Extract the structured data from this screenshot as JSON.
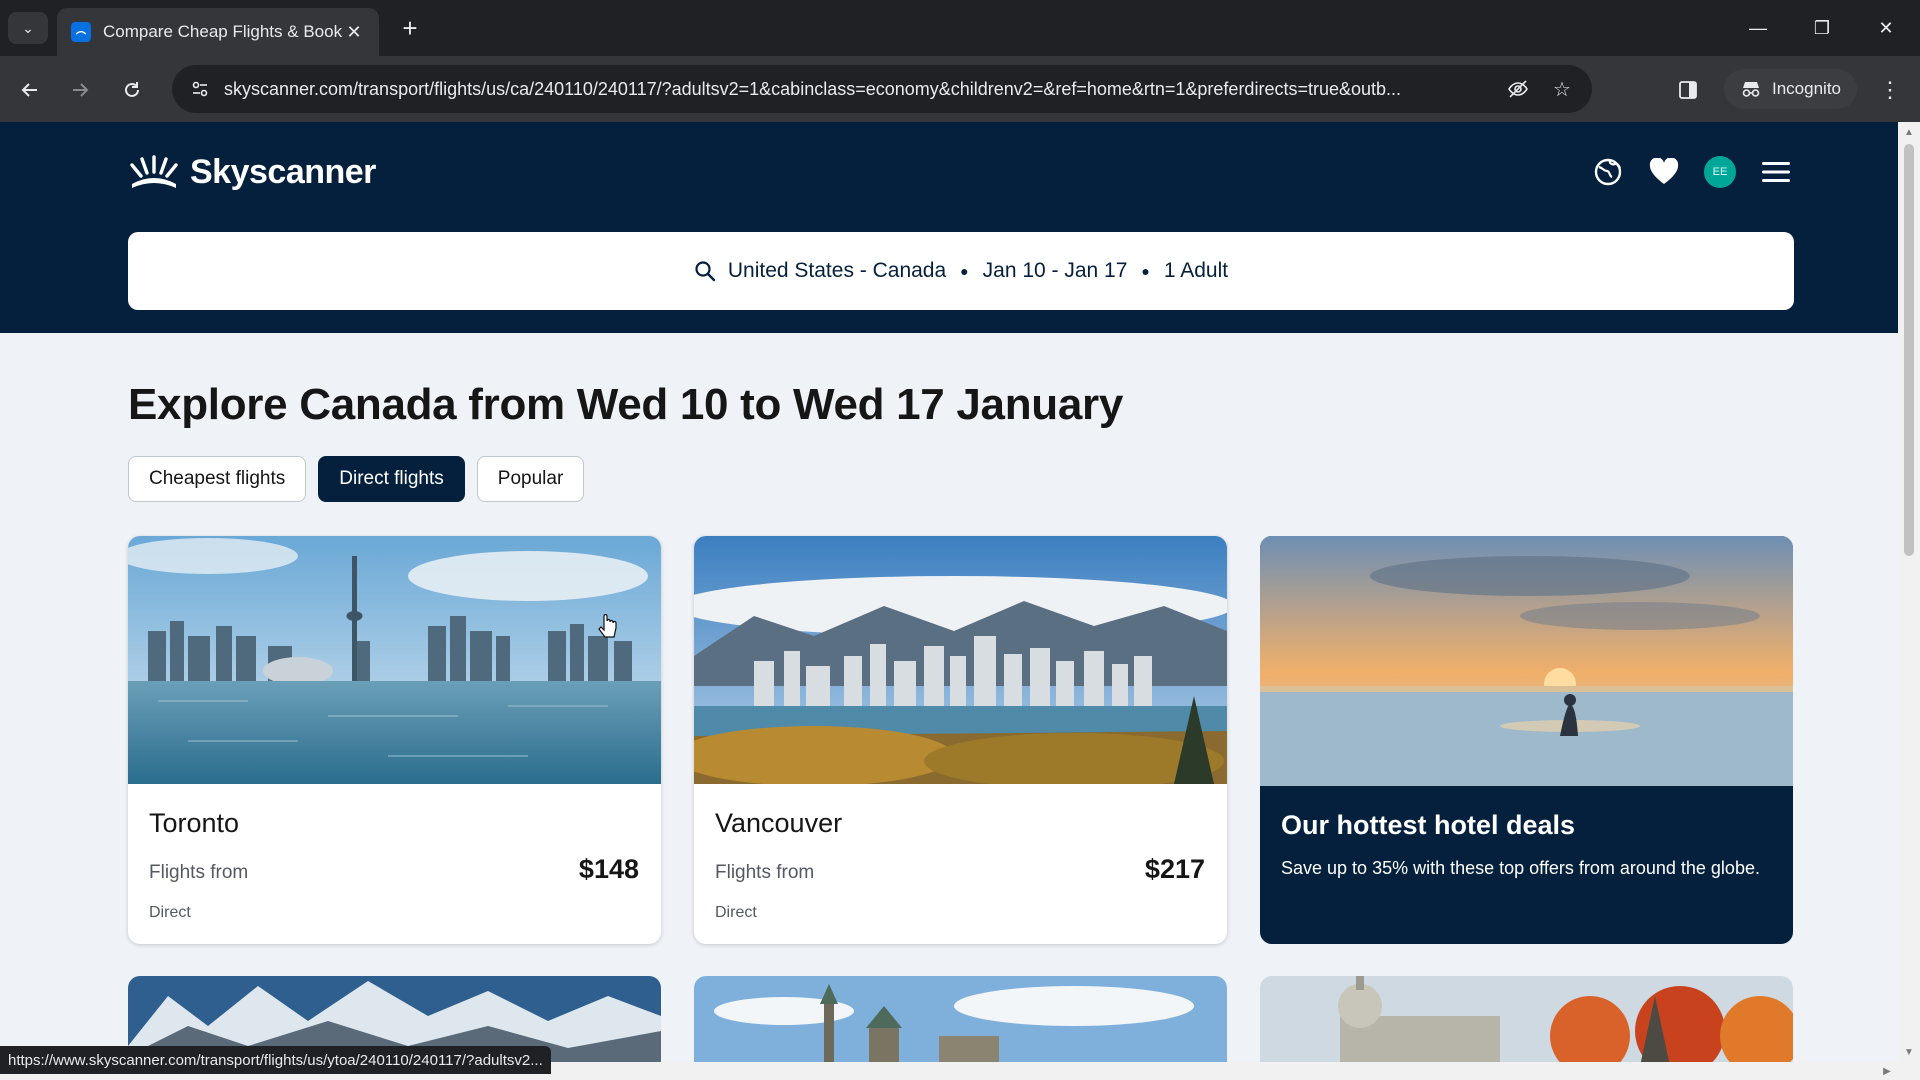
{
  "browser": {
    "tab_title": "Compare Cheap Flights & Book",
    "url": "skyscanner.com/transport/flights/us/ca/240110/240117/?adultsv2=1&cabinclass=economy&childrenv2=&ref=home&rtn=1&preferdirects=true&outb...",
    "incognito_label": "Incognito",
    "status_url": "https://www.skyscanner.com/transport/flights/us/ytoa/240110/240117/?adultsv2..."
  },
  "header": {
    "logo_text": "Skyscanner",
    "avatar_initials": "EE"
  },
  "search": {
    "route": "United States - Canada",
    "dates": "Jan 10 - Jan 17",
    "travellers": "1 Adult"
  },
  "main": {
    "title": "Explore Canada from Wed 10 to Wed 17 January",
    "filters": [
      {
        "label": "Cheapest flights",
        "active": false
      },
      {
        "label": "Direct flights",
        "active": true
      },
      {
        "label": "Popular",
        "active": false
      }
    ],
    "cards": [
      {
        "city": "Toronto",
        "from_label": "Flights from",
        "price": "$148",
        "stops": "Direct"
      },
      {
        "city": "Vancouver",
        "from_label": "Flights from",
        "price": "$217",
        "stops": "Direct"
      }
    ],
    "promo": {
      "title": "Our hottest hotel deals",
      "description": "Save up to 35% with these top offers from around the globe."
    }
  },
  "colors": {
    "brand_navy": "#05203c",
    "page_bg": "#eff3f8",
    "avatar": "#00a698"
  },
  "icons": [
    "search-icon",
    "globe-icon",
    "heart-icon",
    "menu-icon",
    "back-icon",
    "forward-icon",
    "reload-icon",
    "star-icon",
    "eye-off-icon",
    "incognito-icon"
  ]
}
